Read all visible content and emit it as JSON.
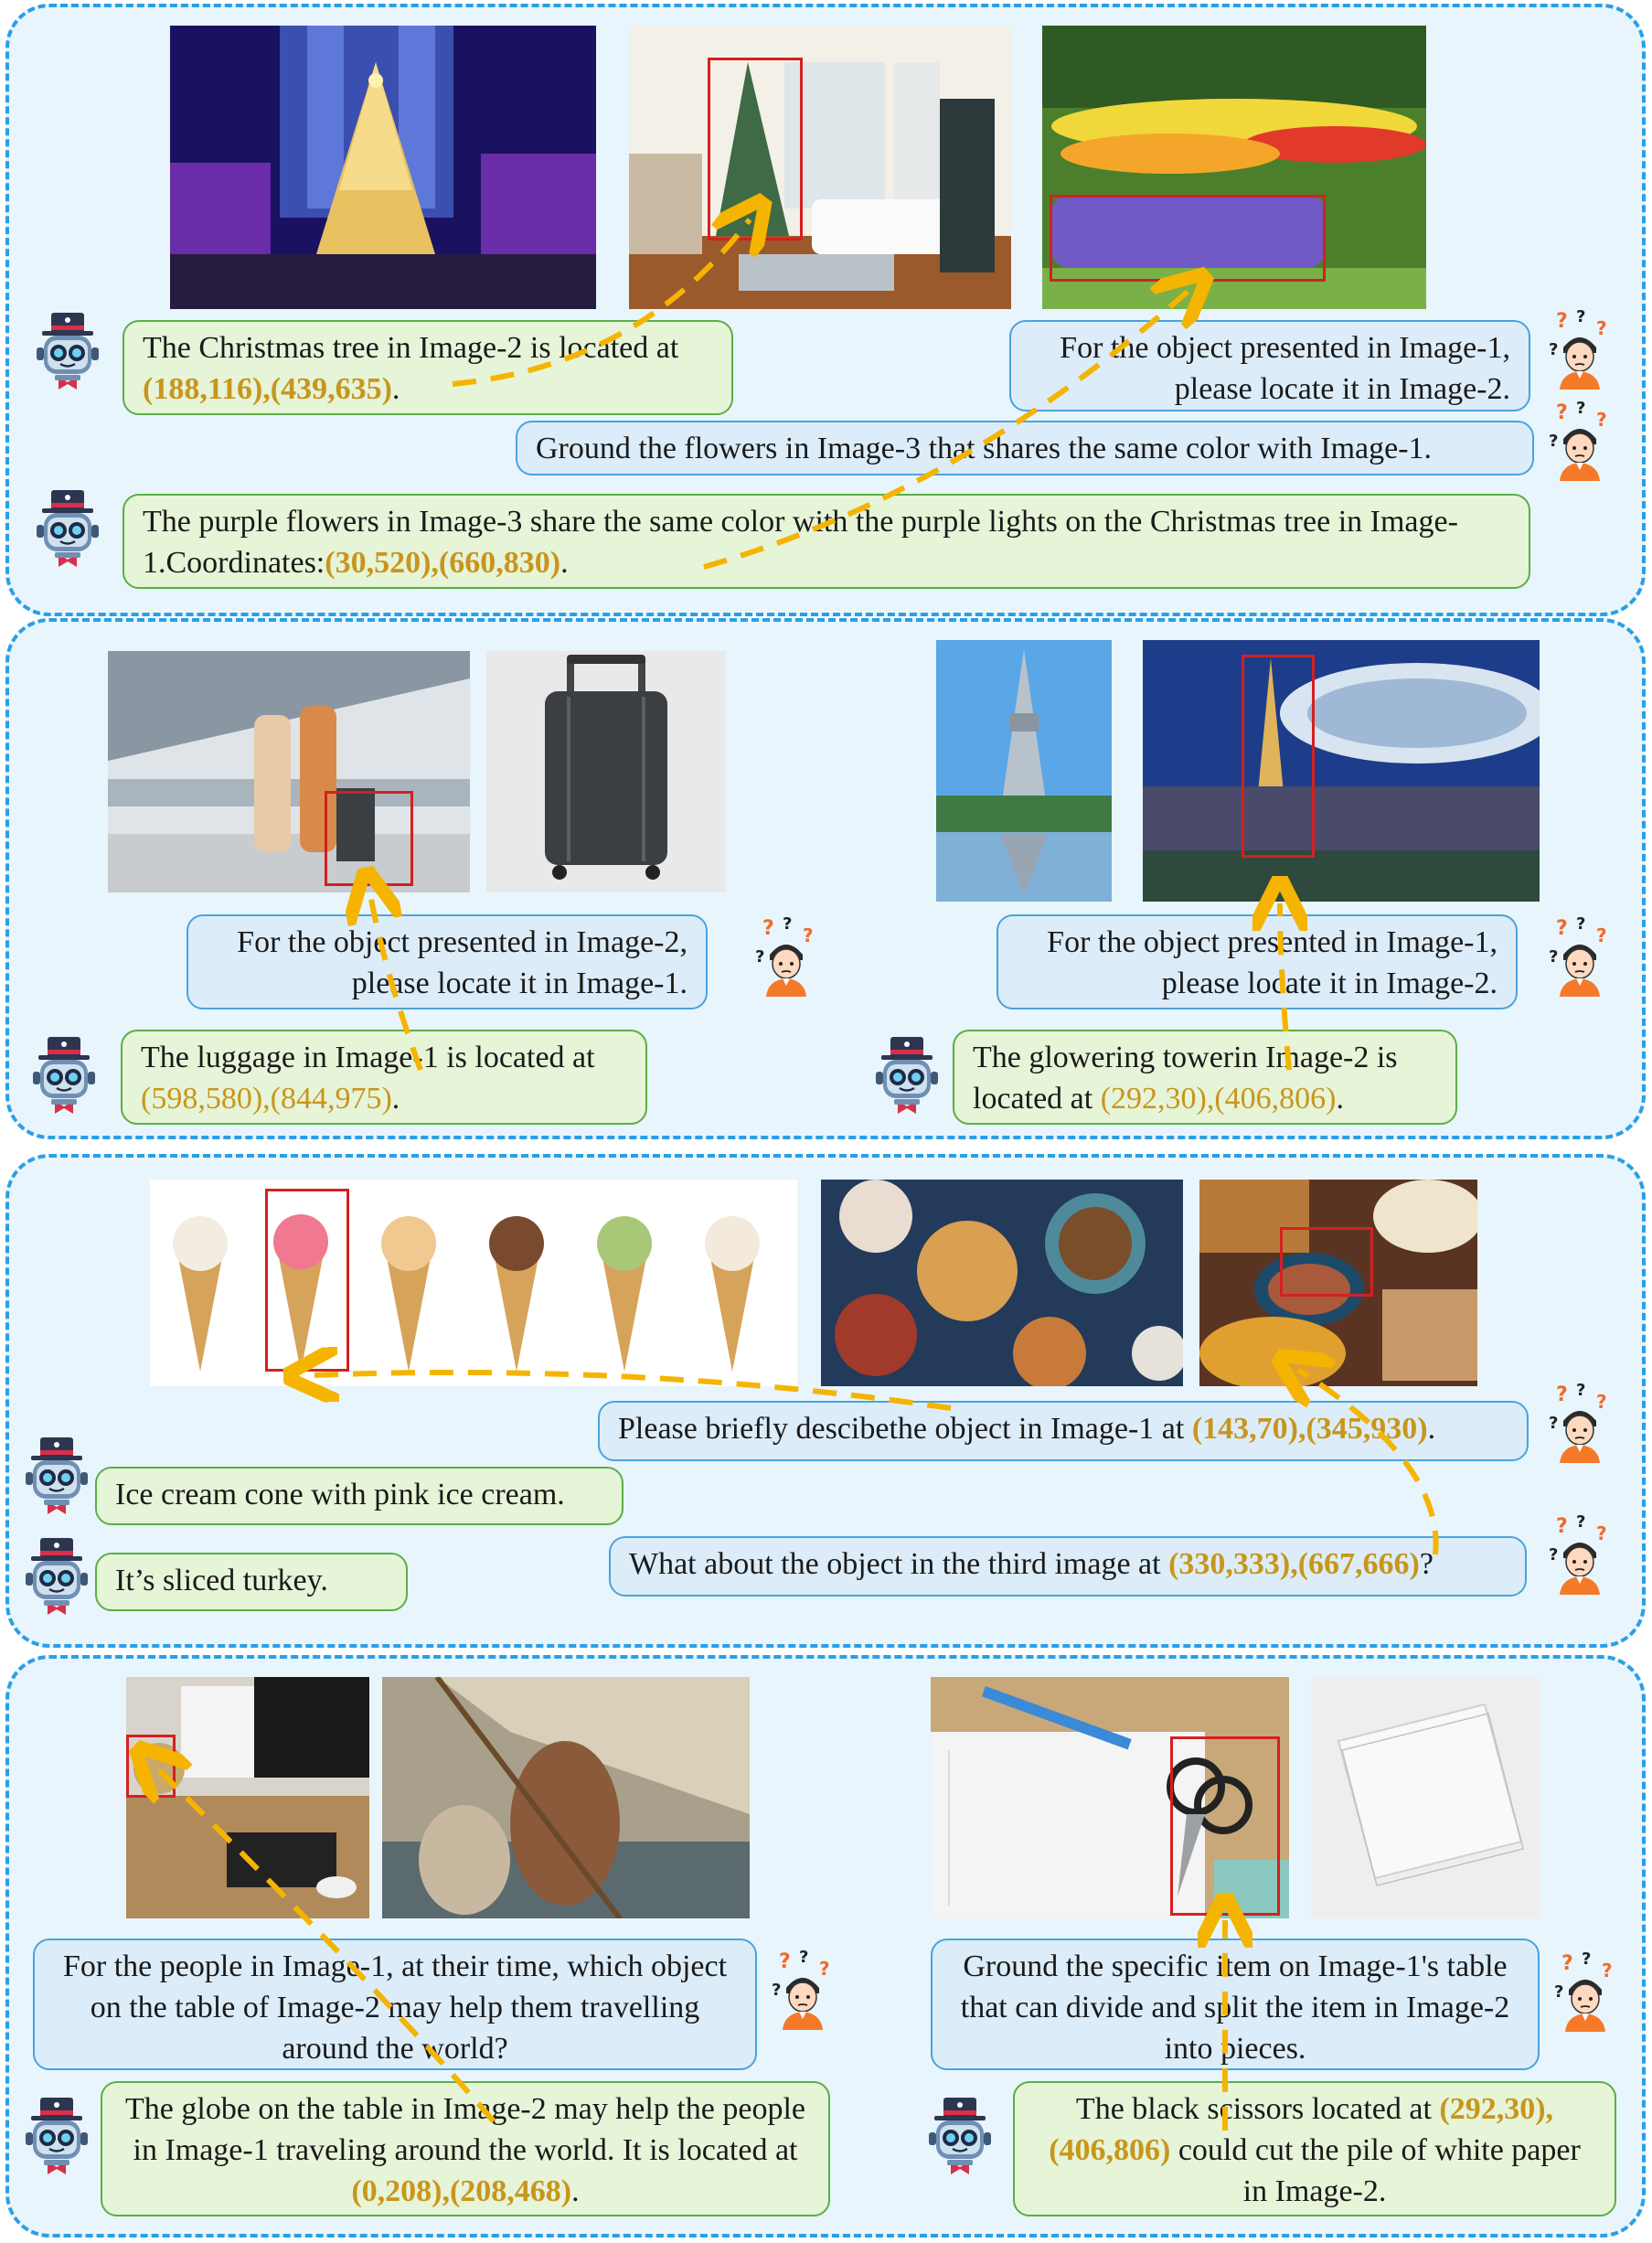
{
  "panel1": {
    "bubble_bot1": {
      "text": "The Christmas tree in Image-2 is located at ",
      "coords": "(188,116),(439,635)",
      "tail": "."
    },
    "bubble_user1": {
      "line1": "For the object presented in Image-1,",
      "line2": "please locate it in Image-2."
    },
    "bubble_user2": {
      "text": "Ground the flowers in Image-3 that shares the same color with Image-1."
    },
    "bubble_bot2": {
      "text": "The purple flowers in Image-3 share the same color with the purple lights on the Christmas tree in Image-1.Coordinates:",
      "coords": "(30,520),(660,830)",
      "tail": "."
    }
  },
  "panel2": {
    "left_user": {
      "line1": "For the object presented in Image-2,",
      "line2": "please locate it in Image-1."
    },
    "left_bot": {
      "text": "The luggage in Image-1 is located at ",
      "coords": "(598,580),(844,975)",
      "tail": "."
    },
    "right_user": {
      "line1": "For the object presented in Image-1,",
      "line2": "please locate it in Image-2."
    },
    "right_bot": {
      "text": "The glowering towerin Image-2 is located at ",
      "coords": "(292,30),(406,806)",
      "tail": "."
    }
  },
  "panel3": {
    "user1": {
      "text": "Please briefly descibethe object in Image-1 at ",
      "coords": "(143,70),(345,930)",
      "tail": "."
    },
    "bot1": {
      "text": "Ice cream cone with pink ice cream."
    },
    "user2": {
      "text": "What about the object in the third image at ",
      "coords": "(330,333),(667,666)",
      "tail": "?"
    },
    "bot2": {
      "text": "It’s sliced turkey."
    }
  },
  "panel4": {
    "left_user": {
      "text": "For the people in Image-1, at their time, which object on the table of Image-2 may help them travelling around the world?"
    },
    "left_bot": {
      "text": "The globe on the table in Image-2 may help the people in Image-1 traveling around the world. It is located at ",
      "coords": "(0,208),(208,468)",
      "tail": "."
    },
    "right_user": {
      "text": "Ground the specific item on Image-1's table that can divide and split the item in Image-2 into pieces."
    },
    "right_bot": {
      "coords": "(292,30),(406,806)",
      "pre": "The black scissors located at ",
      "text": " could cut the pile of white paper in Image-2."
    }
  },
  "colors": {
    "panel_border": "#2a9fe6",
    "panel_fill": "#e8f5fc",
    "user_bubble": "#dcecf9",
    "bot_bubble": "#e6f4d8",
    "coord": "#c8961c",
    "arrow": "#f5b400",
    "box": "#d42020"
  }
}
